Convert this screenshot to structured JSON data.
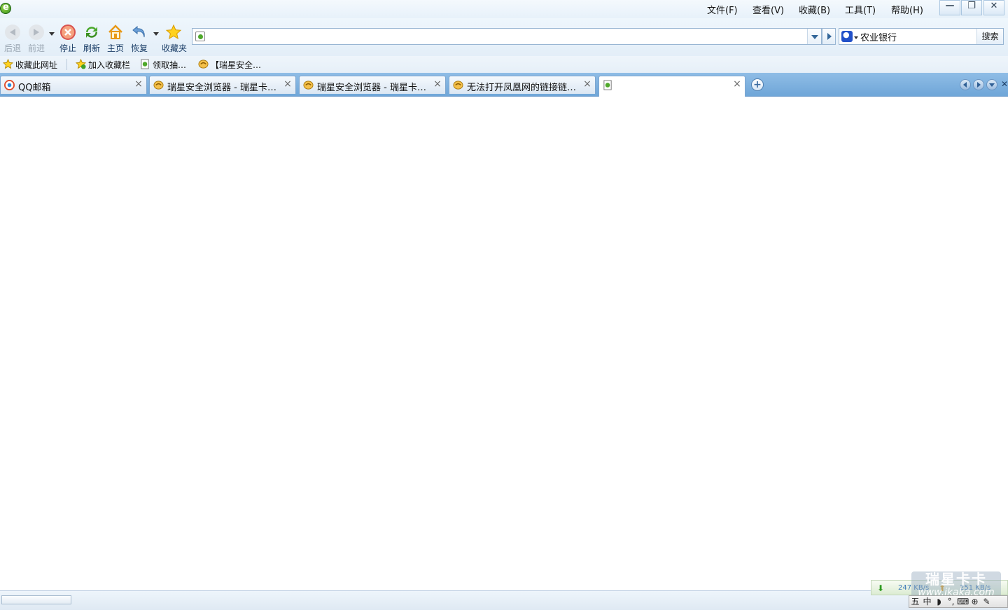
{
  "menu": [
    {
      "label": "文件(F)"
    },
    {
      "label": "查看(V)"
    },
    {
      "label": "收藏(B)"
    },
    {
      "label": "工具(T)"
    },
    {
      "label": "帮助(H)"
    }
  ],
  "window_controls": {
    "minimize": "—",
    "restore": "❐",
    "close": "✕"
  },
  "toolbar": {
    "back": "后退",
    "forward": "前进",
    "stop": "停止",
    "refresh": "刷新",
    "home": "主页",
    "restore": "恢复",
    "favorites": "收藏夹"
  },
  "address": {
    "value": "",
    "placeholder": ""
  },
  "search": {
    "value": "农业银行",
    "button": "搜索",
    "engine_icon": "baidu-paw-icon"
  },
  "favbar": {
    "items": [
      {
        "label": "收藏此网址",
        "icon": "star-icon"
      },
      {
        "label": "加入收藏栏",
        "icon": "star-add-icon"
      },
      {
        "label": "领取抽…",
        "icon": "page-icon"
      },
      {
        "label": "【瑞星安全…",
        "icon": "rising-icon"
      }
    ]
  },
  "tabs": [
    {
      "title": "QQ邮箱",
      "icon": "qq-mail-icon",
      "close": "×"
    },
    {
      "title": "瑞星安全浏览器 - 瑞星卡…",
      "icon": "rising-icon",
      "close": "×"
    },
    {
      "title": "瑞星安全浏览器 - 瑞星卡…",
      "icon": "rising-icon",
      "close": "×"
    },
    {
      "title": "无法打开凤凰网的链接链…",
      "icon": "rising-icon",
      "close": "×"
    },
    {
      "title": "",
      "icon": "page-icon",
      "close": "×",
      "active": true
    }
  ],
  "new_tab": "+",
  "status": {
    "download_speed": "247 KB/s",
    "upload_speed": "251 KB/s",
    "watermark_big": "瑞星卡卡",
    "watermark_url": "www.ikaka.com",
    "ime": [
      "五",
      "中",
      "◗",
      "°,",
      "⌨",
      "⊕",
      "✎"
    ]
  },
  "colors": {
    "tabbar": "#7fb2e0",
    "accent": "#2f8a1c"
  }
}
